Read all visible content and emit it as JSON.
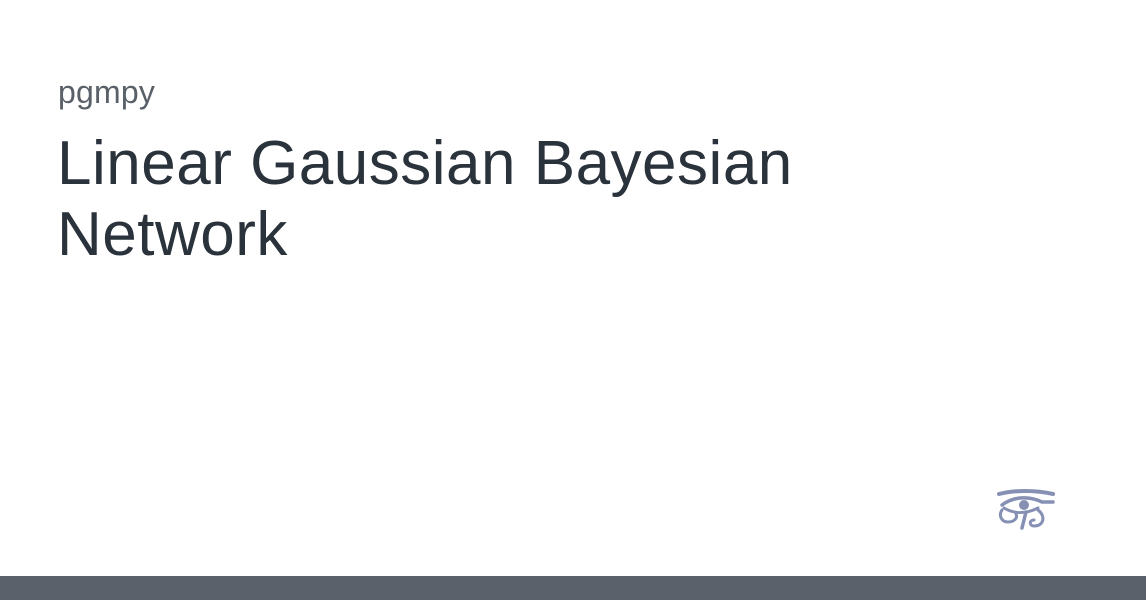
{
  "site": {
    "name": "pgmpy"
  },
  "page": {
    "title": "Linear Gaussian Bayesian Network"
  },
  "logo": {
    "icon": "eye-of-horus-icon",
    "color": "#8590b4"
  },
  "footer_bar": {
    "color": "#5b616b"
  }
}
